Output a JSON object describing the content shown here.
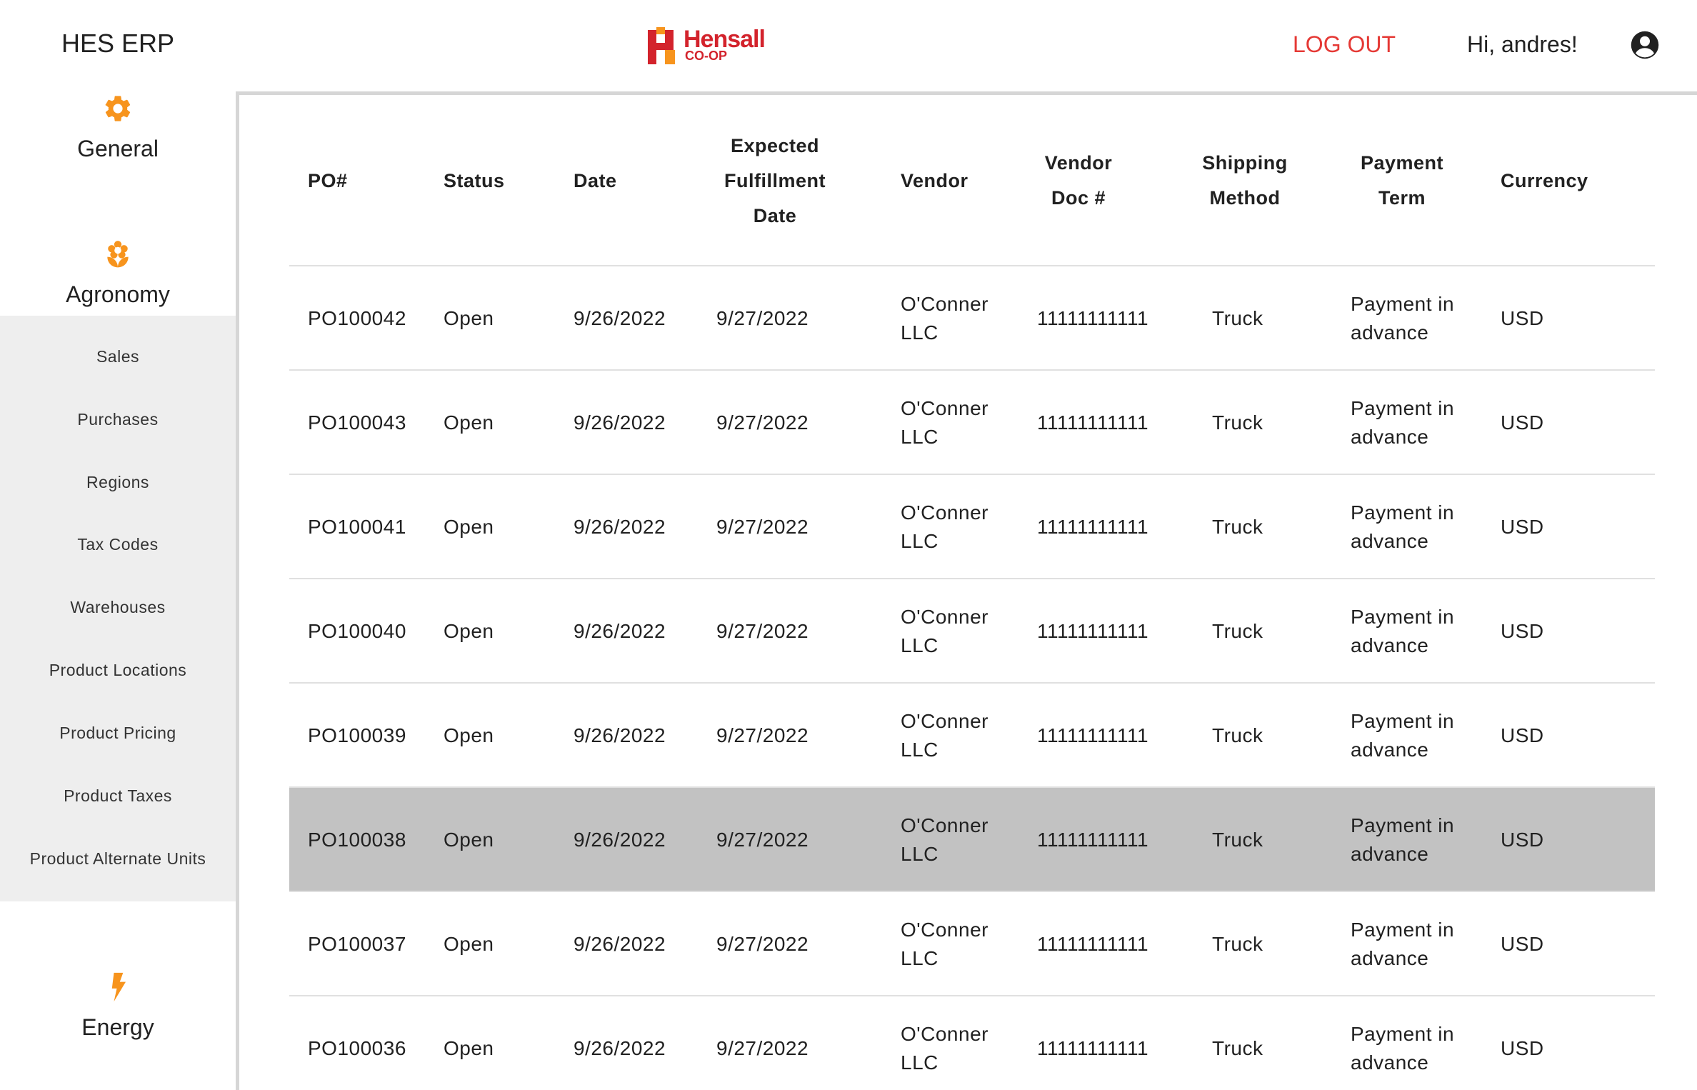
{
  "header": {
    "app_title": "HES ERP",
    "logo_word": "Hensall",
    "logo_sub": "CO-OP",
    "logout_label": "LOG OUT",
    "greeting": "Hi, andres!"
  },
  "colors": {
    "accent": "#f7941d",
    "brand_red": "#d3232c",
    "logout": "#e53935",
    "selected_row": "#c2c2c2",
    "submenu_bg": "#eeeeee"
  },
  "sidebar": {
    "sections": [
      {
        "label": "General",
        "icon": "gear-icon"
      },
      {
        "label": "Agronomy",
        "icon": "flower-icon"
      },
      {
        "label": "Energy",
        "icon": "lightning-icon"
      }
    ],
    "agronomy_items": [
      {
        "label": "Sales"
      },
      {
        "label": "Purchases"
      },
      {
        "label": "Regions"
      },
      {
        "label": "Tax Codes"
      },
      {
        "label": "Warehouses"
      },
      {
        "label": "Product Locations"
      },
      {
        "label": "Product Pricing"
      },
      {
        "label": "Product Taxes"
      },
      {
        "label": "Product Alternate Units"
      }
    ]
  },
  "table": {
    "columns": [
      {
        "lines": [
          "PO#"
        ]
      },
      {
        "lines": [
          "Status"
        ]
      },
      {
        "lines": [
          "Date"
        ]
      },
      {
        "lines": [
          "Expected",
          "Fulfillment",
          "Date"
        ]
      },
      {
        "lines": [
          "Vendor"
        ]
      },
      {
        "lines": [
          "Vendor",
          "Doc #"
        ]
      },
      {
        "lines": [
          "Shipping",
          "Method"
        ]
      },
      {
        "lines": [
          "Payment",
          "Term"
        ]
      },
      {
        "lines": [
          "Currency"
        ]
      }
    ],
    "rows": [
      {
        "po": "PO100042",
        "status": "Open",
        "date": "9/26/2022",
        "expected": "9/27/2022",
        "vendor": "O'Conner LLC",
        "vendor_doc": "11111111111",
        "shipping": "Truck",
        "term": "Payment in advance",
        "currency": "USD",
        "selected": false
      },
      {
        "po": "PO100043",
        "status": "Open",
        "date": "9/26/2022",
        "expected": "9/27/2022",
        "vendor": "O'Conner LLC",
        "vendor_doc": "11111111111",
        "shipping": "Truck",
        "term": "Payment in advance",
        "currency": "USD",
        "selected": false
      },
      {
        "po": "PO100041",
        "status": "Open",
        "date": "9/26/2022",
        "expected": "9/27/2022",
        "vendor": "O'Conner LLC",
        "vendor_doc": "11111111111",
        "shipping": "Truck",
        "term": "Payment in advance",
        "currency": "USD",
        "selected": false
      },
      {
        "po": "PO100040",
        "status": "Open",
        "date": "9/26/2022",
        "expected": "9/27/2022",
        "vendor": "O'Conner LLC",
        "vendor_doc": "11111111111",
        "shipping": "Truck",
        "term": "Payment in advance",
        "currency": "USD",
        "selected": false
      },
      {
        "po": "PO100039",
        "status": "Open",
        "date": "9/26/2022",
        "expected": "9/27/2022",
        "vendor": "O'Conner LLC",
        "vendor_doc": "11111111111",
        "shipping": "Truck",
        "term": "Payment in advance",
        "currency": "USD",
        "selected": false
      },
      {
        "po": "PO100038",
        "status": "Open",
        "date": "9/26/2022",
        "expected": "9/27/2022",
        "vendor": "O'Conner LLC",
        "vendor_doc": "11111111111",
        "shipping": "Truck",
        "term": "Payment in advance",
        "currency": "USD",
        "selected": true
      },
      {
        "po": "PO100037",
        "status": "Open",
        "date": "9/26/2022",
        "expected": "9/27/2022",
        "vendor": "O'Conner LLC",
        "vendor_doc": "11111111111",
        "shipping": "Truck",
        "term": "Payment in advance",
        "currency": "USD",
        "selected": false
      },
      {
        "po": "PO100036",
        "status": "Open",
        "date": "9/26/2022",
        "expected": "9/27/2022",
        "vendor": "O'Conner LLC",
        "vendor_doc": "11111111111",
        "shipping": "Truck",
        "term": "Payment in advance",
        "currency": "USD",
        "selected": false
      }
    ]
  }
}
